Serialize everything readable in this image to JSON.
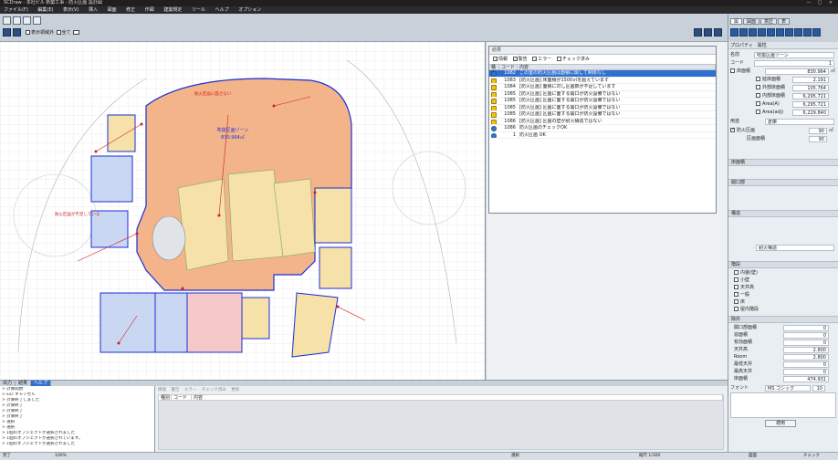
{
  "app": {
    "title": "SCDraw - 本社ビル 新築工事 - 防火区画 設計図",
    "window_buttons": [
      "—",
      "□",
      "×"
    ]
  },
  "menu": [
    "ファイル(F)",
    "編集(E)",
    "表示(V)",
    "挿入",
    "図面",
    "修正",
    "作図",
    "建築規定",
    "ツール",
    "ヘルプ",
    "オプション"
  ],
  "toolbar": {
    "display_option": "表示領域外",
    "all_label": "全て"
  },
  "right_tabs": [
    "属",
    "図面",
    "意匠",
    "表"
  ],
  "canvas": {
    "labels": {
      "center_zone_title": "吹抜区画ゾーン",
      "center_zone_area": "830.964㎡",
      "warn_top": "防火区画に面さない",
      "warn_left": "防火区画が不足している"
    },
    "colors": {
      "zone_orange": "#f3b48a",
      "zone_yellow": "#f6e2a8",
      "zone_blue": "#c9d7f2",
      "zone_pink": "#f6c9c9",
      "wall_blue": "#1c2fd6",
      "leader_red": "#d41c1c"
    }
  },
  "check_panel": {
    "header": "結果",
    "filters": [
      {
        "label": "情報",
        "checked": true
      },
      {
        "label": "警告",
        "checked": true
      },
      {
        "label": "エラー",
        "checked": true
      },
      {
        "label": "チェック済み",
        "checked": false
      }
    ],
    "columns": [
      "種別",
      "コード",
      "内容"
    ],
    "rows": [
      {
        "type": "info",
        "code": "1082",
        "text": "この室の防火区画は面積に関して制限なし",
        "selected": true
      },
      {
        "type": "warn",
        "code": "1083",
        "text": "[防火区画] 床面積が1500㎡を超えています"
      },
      {
        "type": "warn",
        "code": "1084",
        "text": "[防火区画] 面積に対し区画数が不足しています"
      },
      {
        "type": "warn",
        "code": "1085",
        "text": "[防火区画] 区画に面する開口が防火設備ではない"
      },
      {
        "type": "warn",
        "code": "1085",
        "text": "[防火区画] 区画に面する開口が防火設備ではない"
      },
      {
        "type": "warn",
        "code": "1085",
        "text": "[防火区画] 区画に面する開口が防火設備ではない"
      },
      {
        "type": "warn",
        "code": "1085",
        "text": "[防火区画] 区画に面する開口が防火設備ではない"
      },
      {
        "type": "warn",
        "code": "1086",
        "text": "[防火区画] 区画の壁が耐火構造ではない"
      },
      {
        "type": "info",
        "code": "1086",
        "text": "防火区画のチェックOK"
      },
      {
        "type": "info",
        "code": "1",
        "text": "防火区画 OK"
      }
    ]
  },
  "bottom": {
    "tabs": [
      "出力",
      "結果",
      "ヘルプ"
    ],
    "active_tab": "結果",
    "output_lines": [
      "> 計算開始",
      "> Esc キャンセル",
      "> 計算終了しました",
      "> 計算終了",
      "> 計算終了",
      "> 計算終了",
      "> 選択",
      "> 選択",
      "> 1個のオブジェクトが選択されました",
      "> 1個のオブジェクトが選択されています。",
      "> 1個のオブジェクトが選択されました"
    ],
    "err_tools": [
      "情報",
      "警告",
      "エラー",
      "チェック済み",
      "更新"
    ],
    "err_columns": [
      "種別",
      "コード",
      "内容"
    ]
  },
  "properties": {
    "tabbar": [
      "プロパティ",
      "属性"
    ],
    "name_label": "名前",
    "name_value": "吹抜区画ゾーン",
    "code_label": "コード",
    "code_value": "1",
    "floor_area_label": "床面積",
    "floor_area_value": "830.964",
    "area_unit": "㎡",
    "sub_rows": [
      {
        "label": "延床面積",
        "value": "2.191"
      },
      {
        "label": "外部床面積",
        "value": "105.764"
      },
      {
        "label": "内部床面積",
        "value": "6,295.721"
      },
      {
        "label": "Area(A)",
        "value": "6,295.721"
      },
      {
        "label": "Area(adj)",
        "value": "6,229.840"
      }
    ],
    "purpose_label": "用途",
    "purpose_value": "倉庫",
    "fire_label": "防火区画",
    "fire_checked": true,
    "fire_value": "90",
    "fire_unit": "㎡",
    "limit_label": "区画面積",
    "limit_value": "90",
    "section_1": "床面積",
    "section_2": "開口部",
    "section_3": "構造",
    "structure_value": "耐火構造",
    "section_4": "階段",
    "section_5": "除外",
    "options": [
      "内装(壁)",
      "小壁",
      "天井高",
      "一般",
      "床",
      "屋内階段"
    ],
    "numeric_rows": [
      {
        "label": "開口部面積",
        "value": "0"
      },
      {
        "label": "窓面積",
        "value": "0"
      },
      {
        "label": "有効面積",
        "value": "0"
      },
      {
        "label": "天井高",
        "value": "2.800"
      },
      {
        "label": "Room",
        "value": "2.800"
      },
      {
        "label": "最低天井",
        "value": "0"
      },
      {
        "label": "最高天井",
        "value": "0"
      },
      {
        "label": "床面積",
        "value": "474.931"
      }
    ],
    "font_label": "フォント",
    "font_value": "MS ゴシック",
    "font_size": "10",
    "memo_label": "メモ",
    "apply_button": "適用"
  },
  "status": {
    "left": "完了",
    "zoom": "100%",
    "middle": "選択",
    "scale": "縮尺 1/300",
    "layer": "図面",
    "right": "チェック"
  }
}
